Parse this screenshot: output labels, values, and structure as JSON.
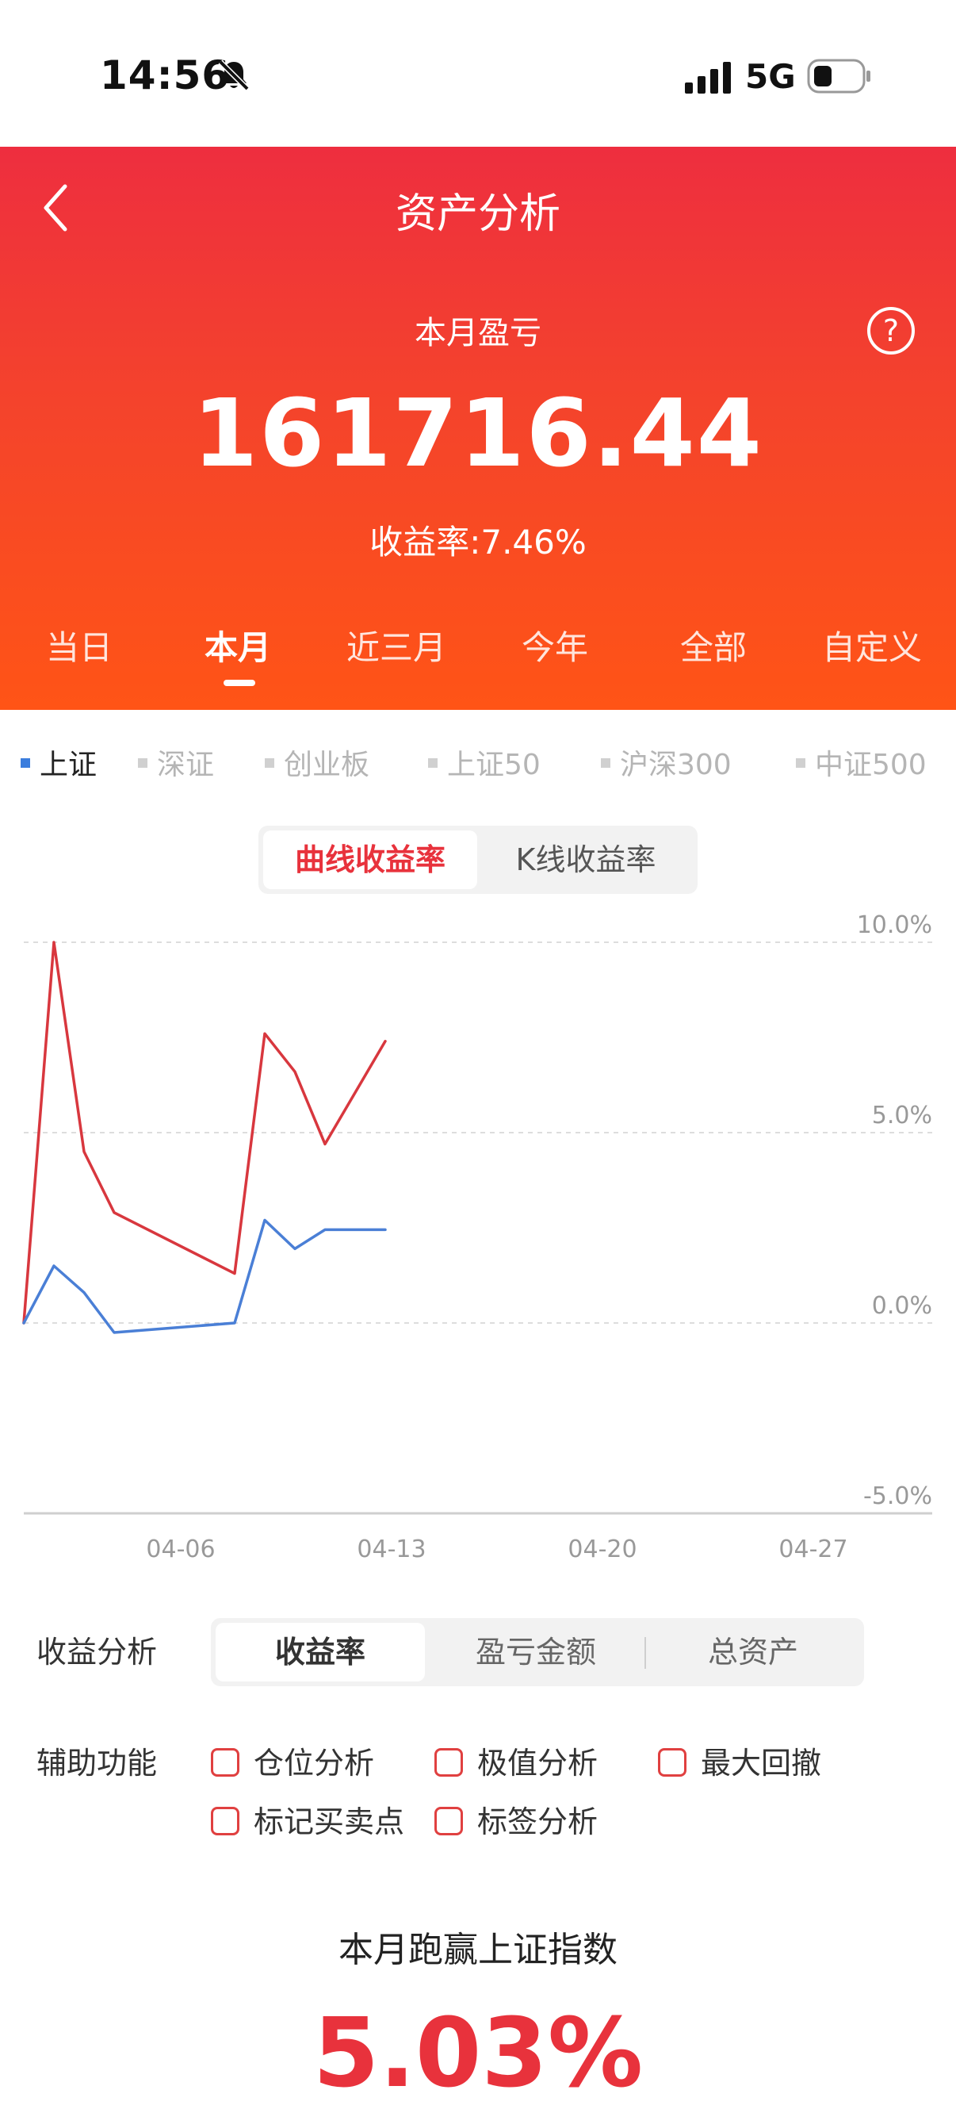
{
  "status_bar": {
    "time": "14:56",
    "network": "5G"
  },
  "nav": {
    "title": "资产分析"
  },
  "summary": {
    "label": "本月盈亏",
    "amount": "161716.44",
    "yield_text": "收益率:7.46%"
  },
  "period_tabs": [
    {
      "label": "当日"
    },
    {
      "label": "本月",
      "active": true
    },
    {
      "label": "近三月"
    },
    {
      "label": "今年"
    },
    {
      "label": "全部"
    },
    {
      "label": "自定义"
    }
  ],
  "index_tabs": [
    {
      "label": "上证",
      "active": true
    },
    {
      "label": "深证"
    },
    {
      "label": "创业板"
    },
    {
      "label": "上证50"
    },
    {
      "label": "沪深300"
    },
    {
      "label": "中证500"
    }
  ],
  "chart_mode": {
    "line_label": "曲线收益率",
    "kline_label": "K线收益率"
  },
  "chart_data": {
    "type": "line",
    "x_ticks": [
      "04-06",
      "04-13",
      "04-20",
      "04-27"
    ],
    "y_ticks": [
      "10.0%",
      "5.0%",
      "0.0%",
      "-5.0%"
    ],
    "ylim": [
      -5,
      10
    ],
    "grid": true,
    "series": [
      {
        "color": "#d8373e",
        "points": [
          [
            "04-01",
            0.0
          ],
          [
            "04-02",
            10.0
          ],
          [
            "04-03",
            4.5
          ],
          [
            "04-04",
            2.9
          ],
          [
            "04-08",
            1.3
          ],
          [
            "04-09",
            7.6
          ],
          [
            "04-10",
            6.6
          ],
          [
            "04-11",
            4.7
          ],
          [
            "04-13",
            7.4
          ]
        ]
      },
      {
        "color": "#4a7fd6",
        "points": [
          [
            "04-01",
            0.0
          ],
          [
            "04-02",
            1.5
          ],
          [
            "04-03",
            0.8
          ],
          [
            "04-04",
            -0.25
          ],
          [
            "04-08",
            0.0
          ],
          [
            "04-09",
            2.7
          ],
          [
            "04-10",
            1.95
          ],
          [
            "04-11",
            2.45
          ],
          [
            "04-13",
            2.45
          ]
        ]
      }
    ]
  },
  "analysis": {
    "label": "收益分析",
    "options": [
      "收益率",
      "盈亏金额",
      "总资产"
    ],
    "active_index": 0
  },
  "aux": {
    "label": "辅助功能",
    "options": [
      "仓位分析",
      "极值分析",
      "最大回撤",
      "标记买卖点",
      "标签分析"
    ]
  },
  "beat": {
    "label": "本月跑赢上证指数",
    "value": "5.03%"
  }
}
